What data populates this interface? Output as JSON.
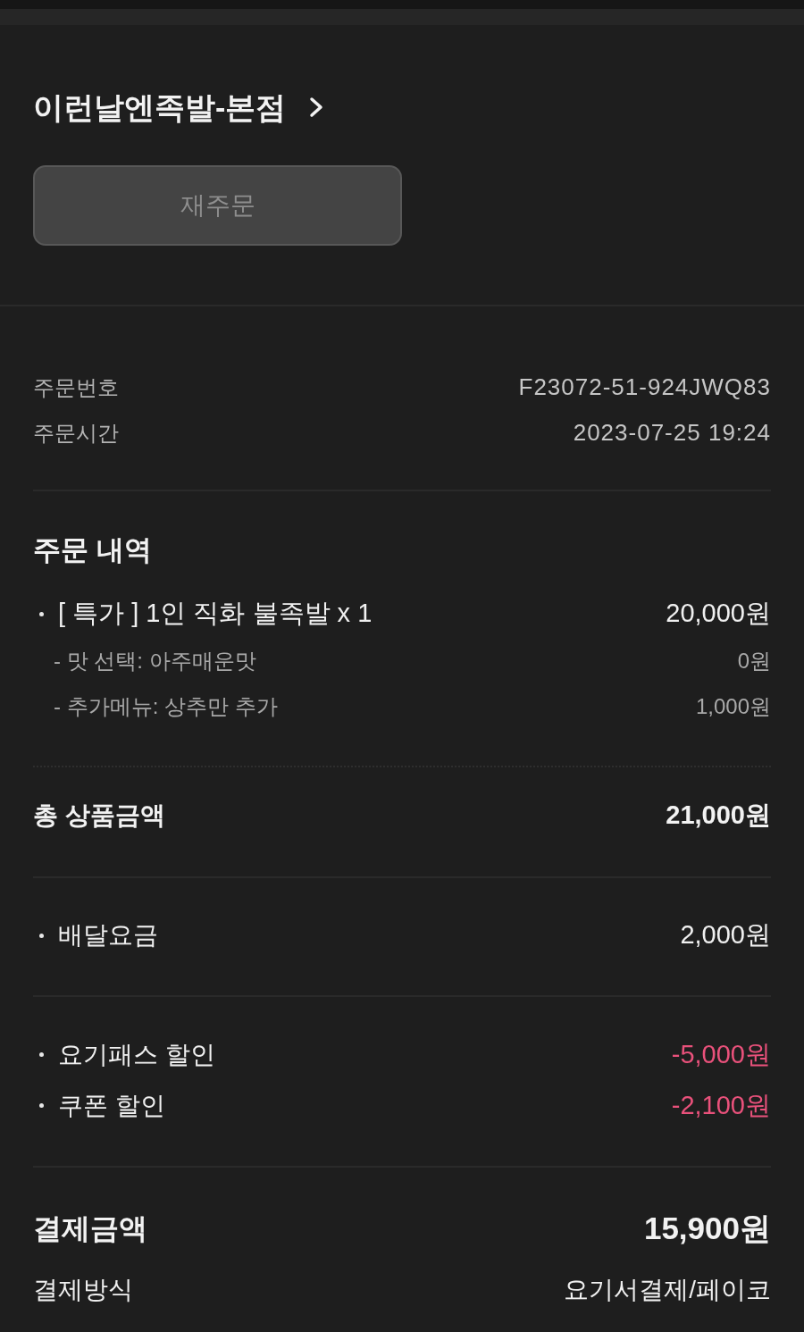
{
  "store": {
    "name": "이런날엔족발-본점"
  },
  "reorder_button": {
    "label": "재주문",
    "disabled": true
  },
  "order_info": [
    {
      "label": "주문번호",
      "value": "F23072-51-924JWQ83"
    },
    {
      "label": "주문시간",
      "value": "2023-07-25 19:24"
    }
  ],
  "order_details": {
    "title": "주문 내역",
    "items": [
      {
        "name": "[ 특가 ] 1인 직화 불족발 x 1",
        "price": "20,000원",
        "options": [
          {
            "label": "- 맛 선택: 아주매운맛",
            "price": "0원"
          },
          {
            "label": "- 추가메뉴: 상추만 추가",
            "price": "1,000원"
          }
        ]
      }
    ]
  },
  "subtotal": {
    "label": "총 상품금액",
    "value": "21,000원"
  },
  "fees": [
    {
      "label": "배달요금",
      "value": "2,000원"
    }
  ],
  "discounts": [
    {
      "label": "요기패스 할인",
      "value": "-5,000원"
    },
    {
      "label": "쿠폰 할인",
      "value": "-2,100원"
    }
  ],
  "payment": {
    "total_label": "결제금액",
    "total_value": "15,900원",
    "method_label": "결제방식",
    "method_value": "요기서결제/페이코"
  }
}
